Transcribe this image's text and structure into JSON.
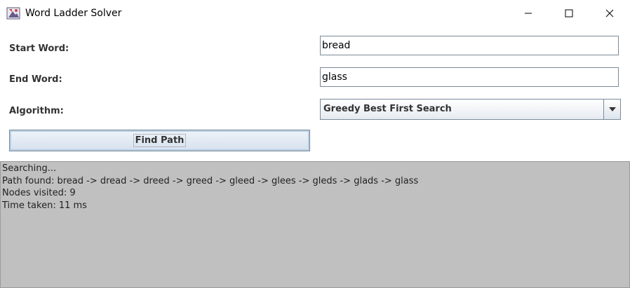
{
  "window": {
    "title": "Word Ladder Solver",
    "controls": [
      "minimize-icon",
      "maximize-icon",
      "close-icon"
    ]
  },
  "form": {
    "start_label": "Start Word:",
    "start_value": "bread",
    "end_label": "End Word:",
    "end_value": "glass",
    "algorithm_label": "Algorithm:",
    "algorithm_selected": "Greedy Best First Search",
    "find_button_label": "Find Path"
  },
  "output": {
    "lines": [
      "Searching...",
      "Path found: bread -> dread -> dreed -> greed -> gleed -> glees -> gleds -> glads -> glass",
      "Nodes visited: 9",
      "Time taken: 11 ms"
    ]
  },
  "colors": {
    "output_background": "#c0c0c0",
    "field_border": "#7a8a99",
    "button_gradient_top": "#eef3f9",
    "button_gradient_bottom": "#d6e1ee"
  }
}
